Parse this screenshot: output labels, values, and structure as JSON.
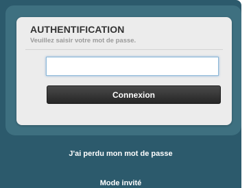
{
  "auth_card": {
    "title": "AUTHENTIFICATION",
    "subtitle": "Veuillez saisir votre mot de passe.",
    "password_value": "",
    "login_button_label": "Connexion"
  },
  "links": {
    "lost_password": "J'ai perdu mon mot de passe",
    "guest_mode": "Mode invité"
  },
  "colors": {
    "panel_background": "#2c5a6c",
    "panel_band": "#3e7080",
    "card_background": "#ececec",
    "button_background": "#2f2f2f",
    "input_focus_glow": "#8cb8d8"
  }
}
